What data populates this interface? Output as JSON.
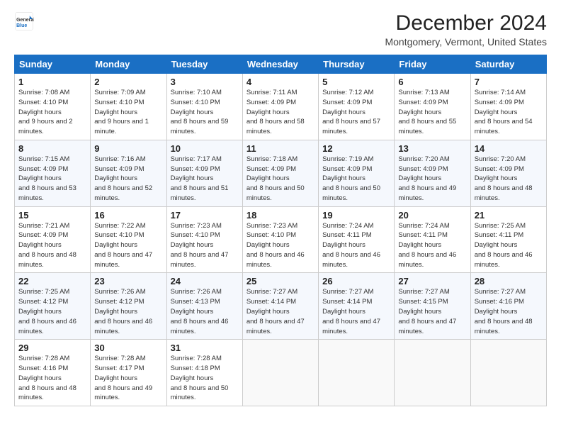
{
  "header": {
    "logo_line1": "General",
    "logo_line2": "Blue",
    "title": "December 2024",
    "subtitle": "Montgomery, Vermont, United States"
  },
  "weekdays": [
    "Sunday",
    "Monday",
    "Tuesday",
    "Wednesday",
    "Thursday",
    "Friday",
    "Saturday"
  ],
  "weeks": [
    [
      {
        "day": "1",
        "sunrise": "7:08 AM",
        "sunset": "4:10 PM",
        "daylight": "9 hours and 2 minutes."
      },
      {
        "day": "2",
        "sunrise": "7:09 AM",
        "sunset": "4:10 PM",
        "daylight": "9 hours and 1 minute."
      },
      {
        "day": "3",
        "sunrise": "7:10 AM",
        "sunset": "4:10 PM",
        "daylight": "8 hours and 59 minutes."
      },
      {
        "day": "4",
        "sunrise": "7:11 AM",
        "sunset": "4:09 PM",
        "daylight": "8 hours and 58 minutes."
      },
      {
        "day": "5",
        "sunrise": "7:12 AM",
        "sunset": "4:09 PM",
        "daylight": "8 hours and 57 minutes."
      },
      {
        "day": "6",
        "sunrise": "7:13 AM",
        "sunset": "4:09 PM",
        "daylight": "8 hours and 55 minutes."
      },
      {
        "day": "7",
        "sunrise": "7:14 AM",
        "sunset": "4:09 PM",
        "daylight": "8 hours and 54 minutes."
      }
    ],
    [
      {
        "day": "8",
        "sunrise": "7:15 AM",
        "sunset": "4:09 PM",
        "daylight": "8 hours and 53 minutes."
      },
      {
        "day": "9",
        "sunrise": "7:16 AM",
        "sunset": "4:09 PM",
        "daylight": "8 hours and 52 minutes."
      },
      {
        "day": "10",
        "sunrise": "7:17 AM",
        "sunset": "4:09 PM",
        "daylight": "8 hours and 51 minutes."
      },
      {
        "day": "11",
        "sunrise": "7:18 AM",
        "sunset": "4:09 PM",
        "daylight": "8 hours and 50 minutes."
      },
      {
        "day": "12",
        "sunrise": "7:19 AM",
        "sunset": "4:09 PM",
        "daylight": "8 hours and 50 minutes."
      },
      {
        "day": "13",
        "sunrise": "7:20 AM",
        "sunset": "4:09 PM",
        "daylight": "8 hours and 49 minutes."
      },
      {
        "day": "14",
        "sunrise": "7:20 AM",
        "sunset": "4:09 PM",
        "daylight": "8 hours and 48 minutes."
      }
    ],
    [
      {
        "day": "15",
        "sunrise": "7:21 AM",
        "sunset": "4:09 PM",
        "daylight": "8 hours and 48 minutes."
      },
      {
        "day": "16",
        "sunrise": "7:22 AM",
        "sunset": "4:10 PM",
        "daylight": "8 hours and 47 minutes."
      },
      {
        "day": "17",
        "sunrise": "7:23 AM",
        "sunset": "4:10 PM",
        "daylight": "8 hours and 47 minutes."
      },
      {
        "day": "18",
        "sunrise": "7:23 AM",
        "sunset": "4:10 PM",
        "daylight": "8 hours and 46 minutes."
      },
      {
        "day": "19",
        "sunrise": "7:24 AM",
        "sunset": "4:11 PM",
        "daylight": "8 hours and 46 minutes."
      },
      {
        "day": "20",
        "sunrise": "7:24 AM",
        "sunset": "4:11 PM",
        "daylight": "8 hours and 46 minutes."
      },
      {
        "day": "21",
        "sunrise": "7:25 AM",
        "sunset": "4:11 PM",
        "daylight": "8 hours and 46 minutes."
      }
    ],
    [
      {
        "day": "22",
        "sunrise": "7:25 AM",
        "sunset": "4:12 PM",
        "daylight": "8 hours and 46 minutes."
      },
      {
        "day": "23",
        "sunrise": "7:26 AM",
        "sunset": "4:12 PM",
        "daylight": "8 hours and 46 minutes."
      },
      {
        "day": "24",
        "sunrise": "7:26 AM",
        "sunset": "4:13 PM",
        "daylight": "8 hours and 46 minutes."
      },
      {
        "day": "25",
        "sunrise": "7:27 AM",
        "sunset": "4:14 PM",
        "daylight": "8 hours and 47 minutes."
      },
      {
        "day": "26",
        "sunrise": "7:27 AM",
        "sunset": "4:14 PM",
        "daylight": "8 hours and 47 minutes."
      },
      {
        "day": "27",
        "sunrise": "7:27 AM",
        "sunset": "4:15 PM",
        "daylight": "8 hours and 47 minutes."
      },
      {
        "day": "28",
        "sunrise": "7:27 AM",
        "sunset": "4:16 PM",
        "daylight": "8 hours and 48 minutes."
      }
    ],
    [
      {
        "day": "29",
        "sunrise": "7:28 AM",
        "sunset": "4:16 PM",
        "daylight": "8 hours and 48 minutes."
      },
      {
        "day": "30",
        "sunrise": "7:28 AM",
        "sunset": "4:17 PM",
        "daylight": "8 hours and 49 minutes."
      },
      {
        "day": "31",
        "sunrise": "7:28 AM",
        "sunset": "4:18 PM",
        "daylight": "8 hours and 50 minutes."
      },
      null,
      null,
      null,
      null
    ]
  ]
}
